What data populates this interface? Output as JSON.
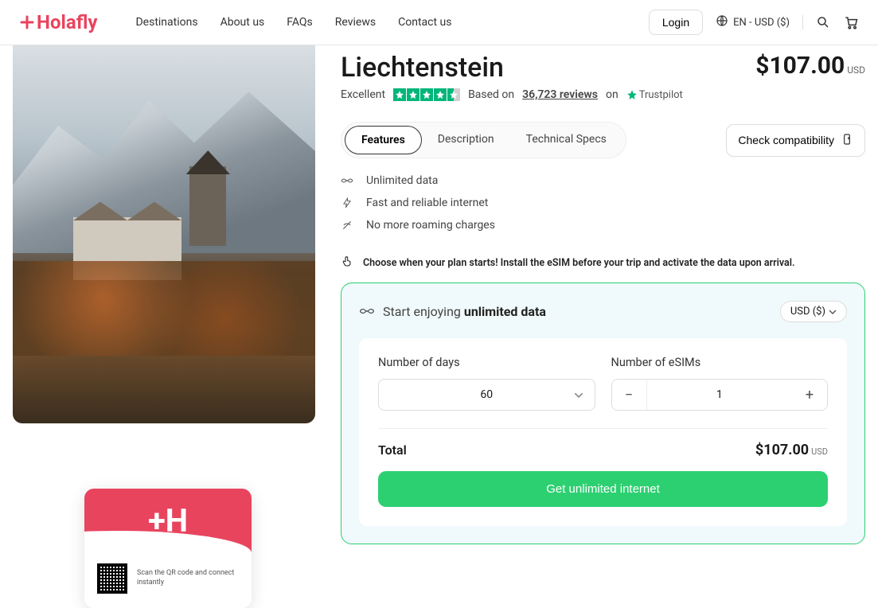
{
  "header": {
    "brand": "Holafly",
    "nav": [
      "Destinations",
      "About us",
      "FAQs",
      "Reviews",
      "Contact us"
    ],
    "login": "Login",
    "locale": "EN - USD ($)"
  },
  "product": {
    "title": "Liechtenstein",
    "price": "$107.00",
    "currency": "USD",
    "rating_label": "Excellent",
    "based_on_prefix": "Based on",
    "reviews_count": "36,723 reviews",
    "on_label": "on",
    "trustpilot": "Trustpilot"
  },
  "tabs": {
    "features": "Features",
    "description": "Description",
    "specs": "Technical Specs"
  },
  "compat_btn": "Check compatibility",
  "features": {
    "f1": "Unlimited data",
    "f2": "Fast and reliable internet",
    "f3": "No more roaming charges"
  },
  "notice": "Choose when your plan starts! Install the eSIM before your trip and activate the data upon arrival.",
  "config": {
    "enjoy_prefix": "Start enjoying",
    "enjoy_bold": "unlimited data",
    "currency_sel": "USD ($)",
    "days_label": "Number of days",
    "days_value": "60",
    "esims_label": "Number of eSIMs",
    "esims_value": "1",
    "total_label": "Total",
    "total_price": "$107.00",
    "total_currency": "USD",
    "cta": "Get unlimited internet"
  },
  "qr": {
    "text": "Scan the QR code and connect instantly"
  }
}
